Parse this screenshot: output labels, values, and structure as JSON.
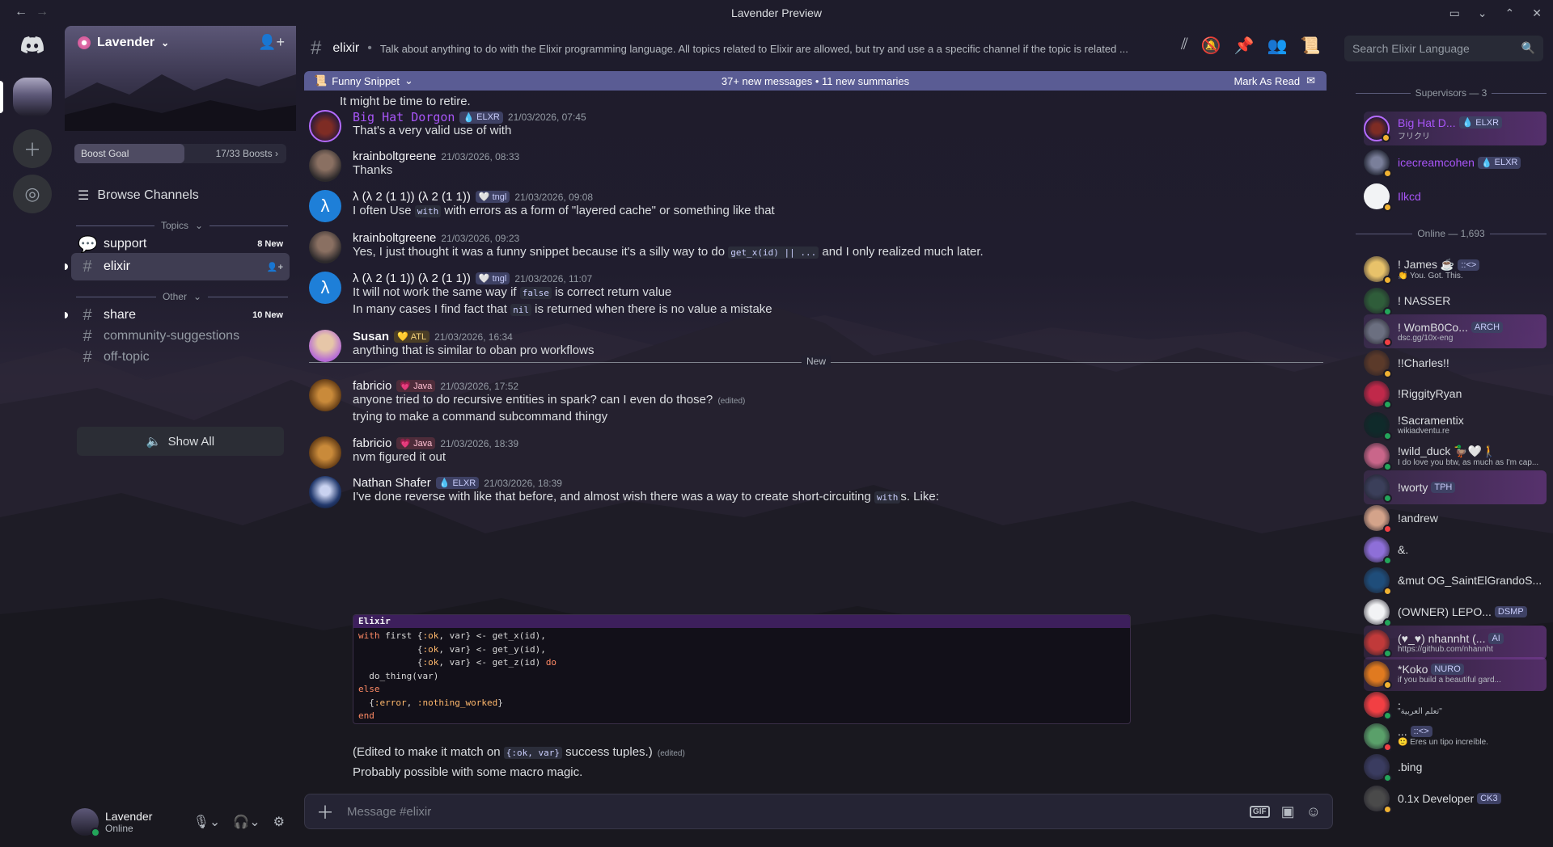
{
  "window": {
    "title": "Lavender Preview",
    "back": "←",
    "forward": "→"
  },
  "server": {
    "name": "Lavender"
  },
  "boost": {
    "label": "Boost Goal",
    "count": "17/33 Boosts",
    "progress": 0.52
  },
  "sidebar": {
    "browse": "Browse Channels",
    "categories": [
      {
        "name": "Topics"
      },
      {
        "name": "Other"
      }
    ],
    "channels": [
      {
        "name": "support",
        "badge": "8 New"
      },
      {
        "name": "elixir",
        "badge": ""
      },
      {
        "name": "share",
        "badge": "10 New"
      },
      {
        "name": "community-suggestions",
        "badge": ""
      },
      {
        "name": "off-topic",
        "badge": ""
      }
    ],
    "show_all": "Show All"
  },
  "user": {
    "name": "Lavender",
    "status": "Online"
  },
  "header": {
    "channel": "elixir",
    "topic": "Talk about anything to do with the Elixir programming language. All topics related to Elixir are allowed, but try and use a a specific channel if the topic is related ..."
  },
  "search": {
    "placeholder": "Search Elixir Language"
  },
  "newbar": {
    "channel": "Funny Snippet",
    "summary": "37+ new messages  •  11 new summaries",
    "mark": "Mark As Read"
  },
  "messages": [
    {
      "text": "It might be time to retire."
    },
    {
      "author": "Big Hat Dorgon",
      "tag": "ELXR",
      "ts": "21/03/2026, 07:45",
      "text": "That's a very valid use of with"
    },
    {
      "author": "krainboltgreene",
      "ts": "21/03/2026, 08:33",
      "text": "Thanks"
    },
    {
      "author": "λ (λ 2 (1 1)) (λ 2 (1 1))",
      "tag": "tngl",
      "ts": "21/03/2026, 09:08",
      "text_a": "I often Use ",
      "code": "with",
      "text_b": " with errors as a form of \"layered cache\" or something like that"
    },
    {
      "author": "krainboltgreene",
      "ts": "21/03/2026, 09:23",
      "text_a": "Yes, I just thought it was a funny snippet because it's a silly way to do ",
      "code": "get_x(id) || ...",
      "text_b": " and I only realized much later."
    },
    {
      "author": "λ (λ 2 (1 1)) (λ 2 (1 1))",
      "tag": "tngl",
      "ts": "21/03/2026, 11:07",
      "text_a": "It will not work the same way if ",
      "code": "false",
      "text_b": " is correct return value",
      "text2_a": "In many cases I find fact that ",
      "code2": "nil",
      "text2_b": " is returned when there is no value a mistake"
    },
    {
      "author": "Susan",
      "tag": "ATL",
      "ts": "21/03/2026, 16:34",
      "text": "anything that is similar to oban pro workflows"
    },
    {
      "author": "fabricio",
      "tag": "Java",
      "ts": "21/03/2026, 17:52",
      "text": "anyone tried to do recursive entities in spark? can I even do those?",
      "edited": "(edited)",
      "text2": "trying to make a command subcommand thingy"
    },
    {
      "author": "fabricio",
      "tag": "Java",
      "ts": "21/03/2026, 18:39",
      "text": "nvm figured it out"
    },
    {
      "author": "Nathan Shafer",
      "tag": "ELXR",
      "ts": "21/03/2026, 18:39",
      "text_a": "I've done reverse with like that before, and almost wish there was a way to create short-circuiting ",
      "code": "with",
      "text_b": "s. Like:",
      "code_lang": "Elixir",
      "after_a": "(Edited to make it match on ",
      "after_code": "{:ok, var}",
      "after_b": " success tuples.)",
      "edited": "(edited)",
      "last": "Probably possible with some macro magic."
    }
  ],
  "divider": "New",
  "composer": {
    "placeholder": "Message #elixir",
    "gif": "GIF"
  },
  "members": {
    "supervisors_label": "Supervisors — 3",
    "online_label": "Online — 1,693",
    "supervisors": [
      {
        "name": "Big Hat D...",
        "tag": "ELXR",
        "sub": "フリクリ"
      },
      {
        "name": "icecreamcohen",
        "tag": "ELXR",
        "sub": ""
      },
      {
        "name": "Ilkcd",
        "tag": "",
        "sub": ""
      }
    ],
    "online": [
      {
        "name": "! James ☕",
        "tag": "::<>",
        "sub": "👏 You. Got. This."
      },
      {
        "name": "! NASSER",
        "tag": "",
        "sub": ""
      },
      {
        "name": "! WomB0Co...",
        "tag": "ARCH",
        "sub": "dsc.gg/10x-eng"
      },
      {
        "name": "!!Charles!!",
        "tag": "",
        "sub": ""
      },
      {
        "name": "!RiggityRyan",
        "tag": "",
        "sub": ""
      },
      {
        "name": "!Sacramentix",
        "tag": "",
        "sub": "wikiadventu.re"
      },
      {
        "name": "!wild_duck 🦆🤍🚶",
        "tag": "",
        "sub": "I do love you btw, as much as I'm cap..."
      },
      {
        "name": "!worty",
        "tag": "TPH",
        "sub": ""
      },
      {
        "name": "!andrew",
        "tag": "",
        "sub": ""
      },
      {
        "name": "&.",
        "tag": "",
        "sub": ""
      },
      {
        "name": "&mut OG_SaintElGrandoS...",
        "tag": "",
        "sub": ""
      },
      {
        "name": "(OWNER) LEPO...",
        "tag": "DSMP",
        "sub": ""
      },
      {
        "name": "(♥_♥) nhannht (...",
        "tag": "AI",
        "sub": "https://github.com/nhannht"
      },
      {
        "name": "*Koko",
        "tag": "NURO",
        "sub": "if you build a beautiful gard..."
      },
      {
        "name": ".",
        "tag": "",
        "sub": "\"تعلم العربية\""
      },
      {
        "name": "...",
        "tag": "::<>",
        "sub": "🙂 Eres un tipo increíble."
      },
      {
        "name": ".bing",
        "tag": "",
        "sub": ""
      },
      {
        "name": "0.1x Developer",
        "tag": "CK3",
        "sub": ""
      }
    ]
  },
  "colors": {
    "accent": "#5865f2",
    "online": "#23a55a",
    "dnd": "#f23f43",
    "idle": "#f0b232",
    "purple_name": "#a855f7"
  }
}
